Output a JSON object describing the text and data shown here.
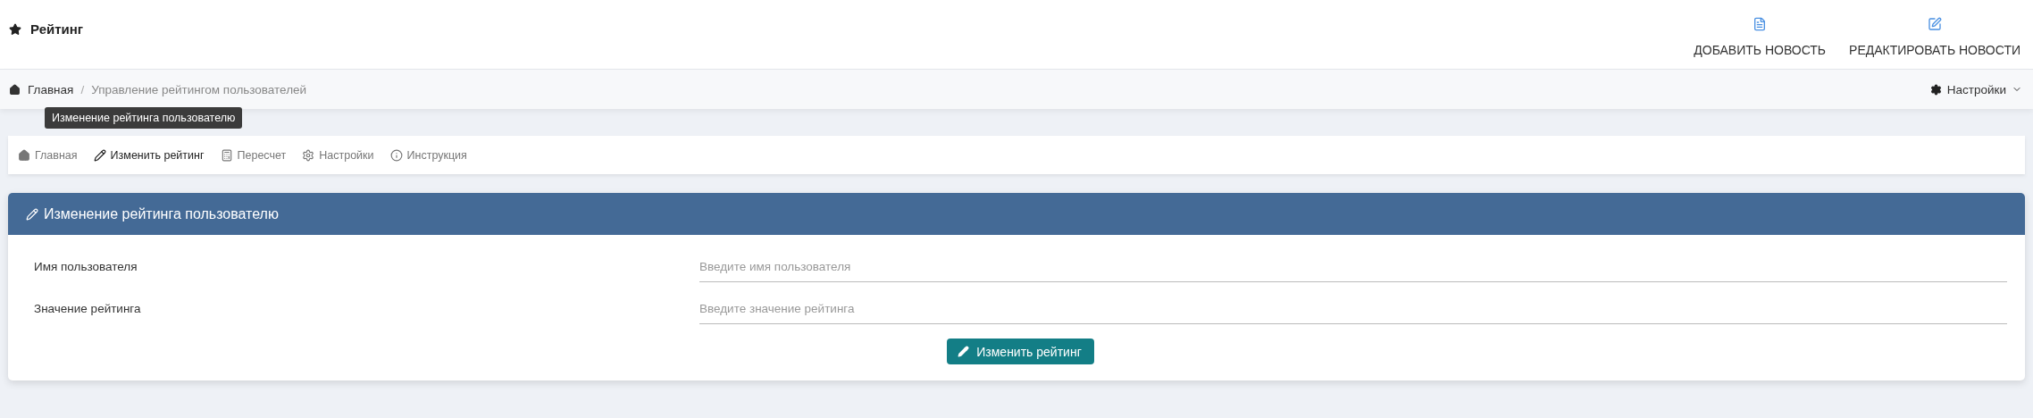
{
  "header": {
    "title": "Рейтинг",
    "actions": [
      {
        "kind": "add",
        "label": "ДОБАВИТЬ НОВОСТЬ"
      },
      {
        "kind": "edit",
        "label": "РЕДАКТИРОВАТЬ НОВОСТИ"
      }
    ]
  },
  "breadcrumb": {
    "items": [
      "Главная",
      "Управление рейтингом пользователей"
    ],
    "separator": "/",
    "settings": "Настройки"
  },
  "tooltip": "Изменение рейтинга пользователю",
  "toolbar": [
    {
      "kind": "home",
      "label": "Главная",
      "selected": false
    },
    {
      "kind": "edit",
      "label": "Изменить рейтинг",
      "selected": true
    },
    {
      "kind": "calc",
      "label": "Пересчет",
      "selected": false
    },
    {
      "kind": "settings",
      "label": "Настройки",
      "selected": false
    },
    {
      "kind": "info",
      "label": "Инструкция",
      "selected": false
    }
  ],
  "panel": {
    "title": "Изменение рейтинга пользователю",
    "fields": [
      {
        "label": "Имя пользователя",
        "placeholder": "Введите имя пользователя"
      },
      {
        "label": "Значение рейтинга",
        "placeholder": "Введите значение рейтинга"
      }
    ],
    "button": "Изменить рейтинг"
  }
}
